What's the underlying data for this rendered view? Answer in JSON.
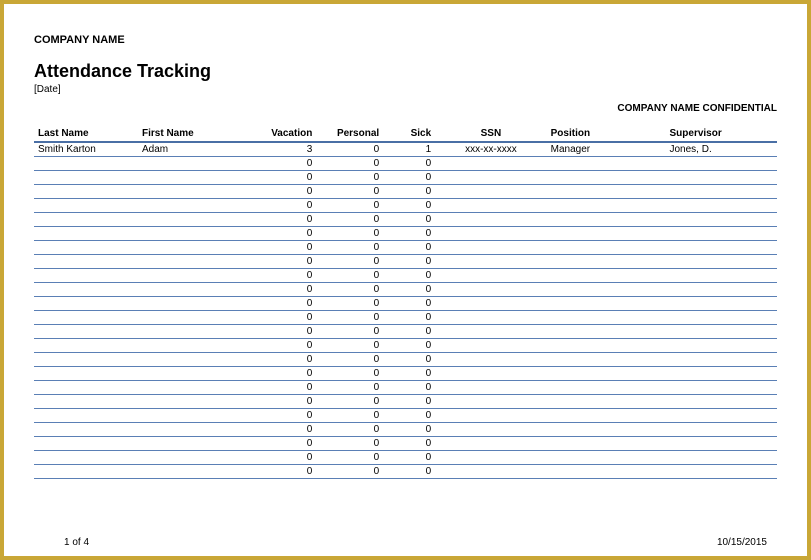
{
  "header": {
    "company_name": "COMPANY NAME",
    "title": "Attendance Tracking",
    "date_label": "[Date]",
    "confidential": "COMPANY NAME CONFIDENTIAL"
  },
  "table": {
    "headers": {
      "last_name": "Last Name",
      "first_name": "First Name",
      "vacation": "Vacation",
      "personal": "Personal",
      "sick": "Sick",
      "ssn": "SSN",
      "position": "Position",
      "supervisor": "Supervisor"
    },
    "rows": [
      {
        "last_name": "Smith Karton",
        "first_name": "Adam",
        "vacation": "3",
        "personal": "0",
        "sick": "1",
        "ssn": "xxx-xx-xxxx",
        "position": "Manager",
        "supervisor": "Jones, D."
      },
      {
        "last_name": "",
        "first_name": "",
        "vacation": "0",
        "personal": "0",
        "sick": "0",
        "ssn": "",
        "position": "",
        "supervisor": ""
      },
      {
        "last_name": "",
        "first_name": "",
        "vacation": "0",
        "personal": "0",
        "sick": "0",
        "ssn": "",
        "position": "",
        "supervisor": ""
      },
      {
        "last_name": "",
        "first_name": "",
        "vacation": "0",
        "personal": "0",
        "sick": "0",
        "ssn": "",
        "position": "",
        "supervisor": ""
      },
      {
        "last_name": "",
        "first_name": "",
        "vacation": "0",
        "personal": "0",
        "sick": "0",
        "ssn": "",
        "position": "",
        "supervisor": ""
      },
      {
        "last_name": "",
        "first_name": "",
        "vacation": "0",
        "personal": "0",
        "sick": "0",
        "ssn": "",
        "position": "",
        "supervisor": ""
      },
      {
        "last_name": "",
        "first_name": "",
        "vacation": "0",
        "personal": "0",
        "sick": "0",
        "ssn": "",
        "position": "",
        "supervisor": ""
      },
      {
        "last_name": "",
        "first_name": "",
        "vacation": "0",
        "personal": "0",
        "sick": "0",
        "ssn": "",
        "position": "",
        "supervisor": ""
      },
      {
        "last_name": "",
        "first_name": "",
        "vacation": "0",
        "personal": "0",
        "sick": "0",
        "ssn": "",
        "position": "",
        "supervisor": ""
      },
      {
        "last_name": "",
        "first_name": "",
        "vacation": "0",
        "personal": "0",
        "sick": "0",
        "ssn": "",
        "position": "",
        "supervisor": ""
      },
      {
        "last_name": "",
        "first_name": "",
        "vacation": "0",
        "personal": "0",
        "sick": "0",
        "ssn": "",
        "position": "",
        "supervisor": ""
      },
      {
        "last_name": "",
        "first_name": "",
        "vacation": "0",
        "personal": "0",
        "sick": "0",
        "ssn": "",
        "position": "",
        "supervisor": ""
      },
      {
        "last_name": "",
        "first_name": "",
        "vacation": "0",
        "personal": "0",
        "sick": "0",
        "ssn": "",
        "position": "",
        "supervisor": ""
      },
      {
        "last_name": "",
        "first_name": "",
        "vacation": "0",
        "personal": "0",
        "sick": "0",
        "ssn": "",
        "position": "",
        "supervisor": ""
      },
      {
        "last_name": "",
        "first_name": "",
        "vacation": "0",
        "personal": "0",
        "sick": "0",
        "ssn": "",
        "position": "",
        "supervisor": ""
      },
      {
        "last_name": "",
        "first_name": "",
        "vacation": "0",
        "personal": "0",
        "sick": "0",
        "ssn": "",
        "position": "",
        "supervisor": ""
      },
      {
        "last_name": "",
        "first_name": "",
        "vacation": "0",
        "personal": "0",
        "sick": "0",
        "ssn": "",
        "position": "",
        "supervisor": ""
      },
      {
        "last_name": "",
        "first_name": "",
        "vacation": "0",
        "personal": "0",
        "sick": "0",
        "ssn": "",
        "position": "",
        "supervisor": ""
      },
      {
        "last_name": "",
        "first_name": "",
        "vacation": "0",
        "personal": "0",
        "sick": "0",
        "ssn": "",
        "position": "",
        "supervisor": ""
      },
      {
        "last_name": "",
        "first_name": "",
        "vacation": "0",
        "personal": "0",
        "sick": "0",
        "ssn": "",
        "position": "",
        "supervisor": ""
      },
      {
        "last_name": "",
        "first_name": "",
        "vacation": "0",
        "personal": "0",
        "sick": "0",
        "ssn": "",
        "position": "",
        "supervisor": ""
      },
      {
        "last_name": "",
        "first_name": "",
        "vacation": "0",
        "personal": "0",
        "sick": "0",
        "ssn": "",
        "position": "",
        "supervisor": ""
      },
      {
        "last_name": "",
        "first_name": "",
        "vacation": "0",
        "personal": "0",
        "sick": "0",
        "ssn": "",
        "position": "",
        "supervisor": ""
      },
      {
        "last_name": "",
        "first_name": "",
        "vacation": "0",
        "personal": "0",
        "sick": "0",
        "ssn": "",
        "position": "",
        "supervisor": ""
      }
    ]
  },
  "footer": {
    "page": "1 of 4",
    "date": "10/15/2015"
  }
}
